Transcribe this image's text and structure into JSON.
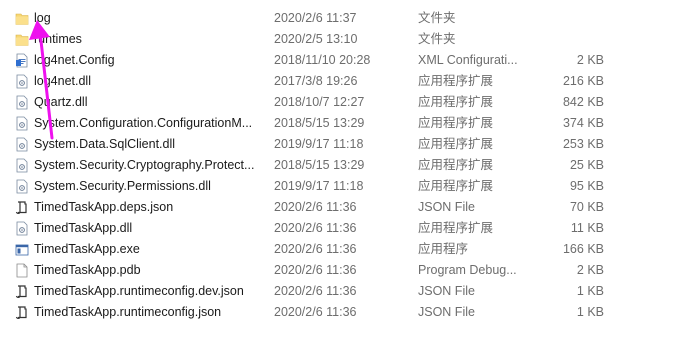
{
  "files": [
    {
      "icon": "folder-icon",
      "name": "log",
      "date": "2020/2/6 11:37",
      "type": "文件夹",
      "size": ""
    },
    {
      "icon": "folder-icon",
      "name": "runtimes",
      "date": "2020/2/5 13:10",
      "type": "文件夹",
      "size": ""
    },
    {
      "icon": "config-file-icon",
      "name": "log4net.Config",
      "date": "2018/11/10 20:28",
      "type": "XML Configurati...",
      "size": "2 KB"
    },
    {
      "icon": "dll-file-icon",
      "name": "log4net.dll",
      "date": "2017/3/8 19:26",
      "type": "应用程序扩展",
      "size": "216 KB"
    },
    {
      "icon": "dll-file-icon",
      "name": "Quartz.dll",
      "date": "2018/10/7 12:27",
      "type": "应用程序扩展",
      "size": "842 KB"
    },
    {
      "icon": "dll-file-icon",
      "name": "System.Configuration.ConfigurationM...",
      "date": "2018/5/15 13:29",
      "type": "应用程序扩展",
      "size": "374 KB"
    },
    {
      "icon": "dll-file-icon",
      "name": "System.Data.SqlClient.dll",
      "date": "2019/9/17 11:18",
      "type": "应用程序扩展",
      "size": "253 KB"
    },
    {
      "icon": "dll-file-icon",
      "name": "System.Security.Cryptography.Protect...",
      "date": "2018/5/15 13:29",
      "type": "应用程序扩展",
      "size": "25 KB"
    },
    {
      "icon": "dll-file-icon",
      "name": "System.Security.Permissions.dll",
      "date": "2019/9/17 11:18",
      "type": "应用程序扩展",
      "size": "95 KB"
    },
    {
      "icon": "json-file-icon",
      "name": "TimedTaskApp.deps.json",
      "date": "2020/2/6 11:36",
      "type": "JSON File",
      "size": "70 KB"
    },
    {
      "icon": "dll-file-icon",
      "name": "TimedTaskApp.dll",
      "date": "2020/2/6 11:36",
      "type": "应用程序扩展",
      "size": "11 KB"
    },
    {
      "icon": "exe-file-icon",
      "name": "TimedTaskApp.exe",
      "date": "2020/2/6 11:36",
      "type": "应用程序",
      "size": "166 KB"
    },
    {
      "icon": "blank-file-icon",
      "name": "TimedTaskApp.pdb",
      "date": "2020/2/6 11:36",
      "type": "Program Debug...",
      "size": "2 KB"
    },
    {
      "icon": "json-file-icon",
      "name": "TimedTaskApp.runtimeconfig.dev.json",
      "date": "2020/2/6 11:36",
      "type": "JSON File",
      "size": "1 KB"
    },
    {
      "icon": "json-file-icon",
      "name": "TimedTaskApp.runtimeconfig.json",
      "date": "2020/2/6 11:36",
      "type": "JSON File",
      "size": "1 KB"
    }
  ],
  "annotation": {
    "icon": "arrow-annotation-icon",
    "color": "#ee11ee"
  }
}
